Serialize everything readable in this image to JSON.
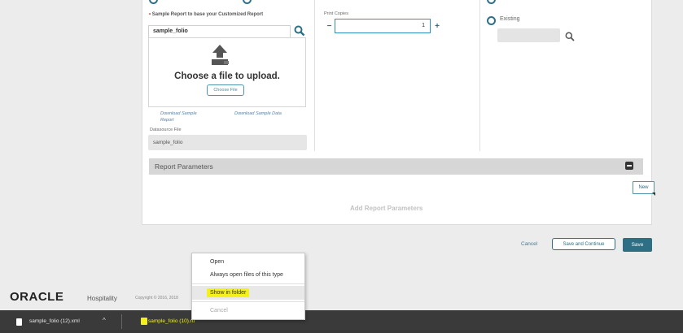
{
  "form": {
    "template_label": "Sample Report to base your Customized Report",
    "template_value": "sample_folio",
    "upload_heading": "Choose a file to upload.",
    "choose_file": "Choose File",
    "download_report": "Download Sample Report",
    "download_data": "Download Sample Data",
    "datasource_label": "Datasource File",
    "datasource_value": "sample_folio",
    "print_copies_label": "Print Copies",
    "print_copies_value": "1",
    "minus": "−",
    "plus": "+",
    "existing_label": "Existing"
  },
  "params": {
    "title": "Report Parameters",
    "new_button": "New",
    "empty_text": "Add Report Parameters"
  },
  "actions": {
    "cancel": "Cancel",
    "save_continue": "Save and Continue",
    "save": "Save"
  },
  "footer": {
    "logo": "ORACLE",
    "brand": "Hospitality",
    "copyright": "Copyright © 2016, 2018"
  },
  "context_menu": {
    "items": [
      "Open",
      "Always open files of this type",
      "Show in folder",
      "Cancel"
    ]
  },
  "downloads": [
    {
      "name": "sample_folio (12).xml"
    },
    {
      "name": "sample_folio (10).rtf"
    }
  ],
  "colors": {
    "accent": "#2f6f86",
    "highlight": "#f4f01a",
    "download_bar": "#3a3a3a"
  }
}
